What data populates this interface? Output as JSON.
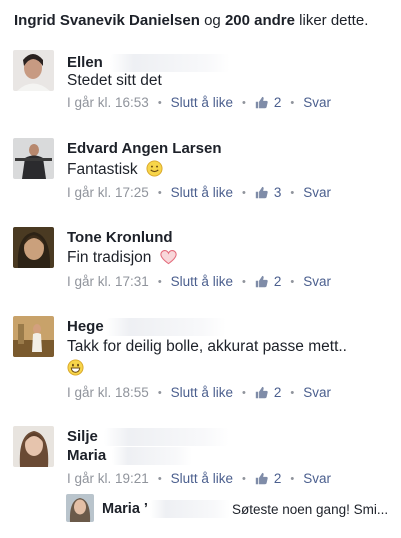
{
  "likes_summary": {
    "name": "Ingrid Svanevik Danielsen",
    "connector": "og",
    "count_text": "200 andre",
    "suffix": "liker dette."
  },
  "comments": [
    {
      "author": "Ellen",
      "text": "Stedet sitt det",
      "time": "I går kl. 16:53",
      "unlike_label": "Slutt å like",
      "like_count": "2",
      "reply_label": "Svar"
    },
    {
      "author": "Edvard Angen Larsen",
      "text": "Fantastisk",
      "emoji": "smile",
      "time": "I går kl. 17:25",
      "unlike_label": "Slutt å like",
      "like_count": "3",
      "reply_label": "Svar"
    },
    {
      "author": "Tone Kronlund",
      "text": "Fin tradisjon",
      "emoji": "heart",
      "time": "I går kl. 17:31",
      "unlike_label": "Slutt å like",
      "like_count": "2",
      "reply_label": "Svar"
    },
    {
      "author": "Hege",
      "text": "Takk for deilig bolle, akkurat passe mett..",
      "emoji": "grin",
      "time": "I går kl. 18:55",
      "unlike_label": "Slutt å like",
      "like_count": "2",
      "reply_label": "Svar"
    },
    {
      "author": "Silje",
      "author_line2": "Maria",
      "time": "I går kl. 19:21",
      "unlike_label": "Slutt å like",
      "like_count": "2",
      "reply_label": "Svar"
    }
  ],
  "reply": {
    "author": "Maria",
    "author_trail": "’",
    "text": "Søteste noen gang! Smi..."
  },
  "colors": {
    "text": "#1d2129",
    "meta": "#90949c",
    "link": "#4b5f8e"
  },
  "icons": [
    "thumbs-up-icon",
    "smile-emoji-icon",
    "heart-emoji-icon",
    "grin-emoji-icon"
  ]
}
